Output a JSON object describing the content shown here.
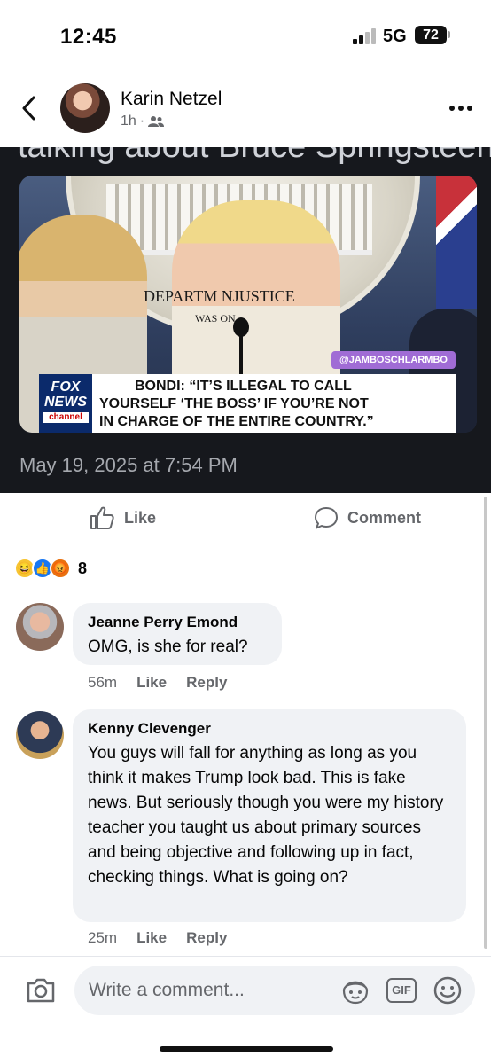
{
  "status_bar": {
    "time": "12:45",
    "network": "5G",
    "battery": "72"
  },
  "header": {
    "author": "Karin Netzel",
    "time_ago": "1h",
    "separator": "·",
    "audience_icon": "friends-icon",
    "back_icon": "chevron-left-icon",
    "more_icon": "more-horizontal-icon"
  },
  "embed": {
    "cut_text": "talking about Bruce Springsteen",
    "seal_text": "DEPARTM       NJUSTICE",
    "seal_subtext": "WAS          ON",
    "watermark": "@JAMBOSCHLARMBO",
    "fox_logo_line1": "FOX",
    "fox_logo_line2": "NEWS",
    "fox_logo_line3": "channel",
    "headline_line1": "BONDI: “IT’S ILLEGAL TO CALL",
    "headline_line2": "YOURSELF ‘THE BOSS’ IF YOU’RE NOT",
    "headline_line3": "IN CHARGE OF THE ENTIRE COUNTRY.”",
    "date": "May 19, 2025 at 7:54 PM"
  },
  "actions": {
    "like": "Like",
    "comment": "Comment"
  },
  "reactions": {
    "icons": [
      "haha-icon",
      "like-icon",
      "angry-icon"
    ],
    "count": "8"
  },
  "comments": [
    {
      "name": "Jeanne Perry Emond",
      "text": "OMG, is she for real?",
      "time": "56m",
      "like": "Like",
      "reply": "Reply"
    },
    {
      "name": "Kenny Clevenger",
      "text": "You guys will fall for anything as long as you think it makes Trump look bad. This is fake news. But seriously though you were my history teacher you taught us about primary sources and being objective and following up in fact, checking things. What is going on?",
      "time": "25m",
      "like": "Like",
      "reply": "Reply"
    }
  ],
  "composer": {
    "placeholder": "Write a comment...",
    "gif": "GIF"
  },
  "colors": {
    "brand_blue": "#1877f2",
    "secondary_text": "#65676b",
    "bubble": "#f0f2f5",
    "dark_embed": "#16181d"
  }
}
